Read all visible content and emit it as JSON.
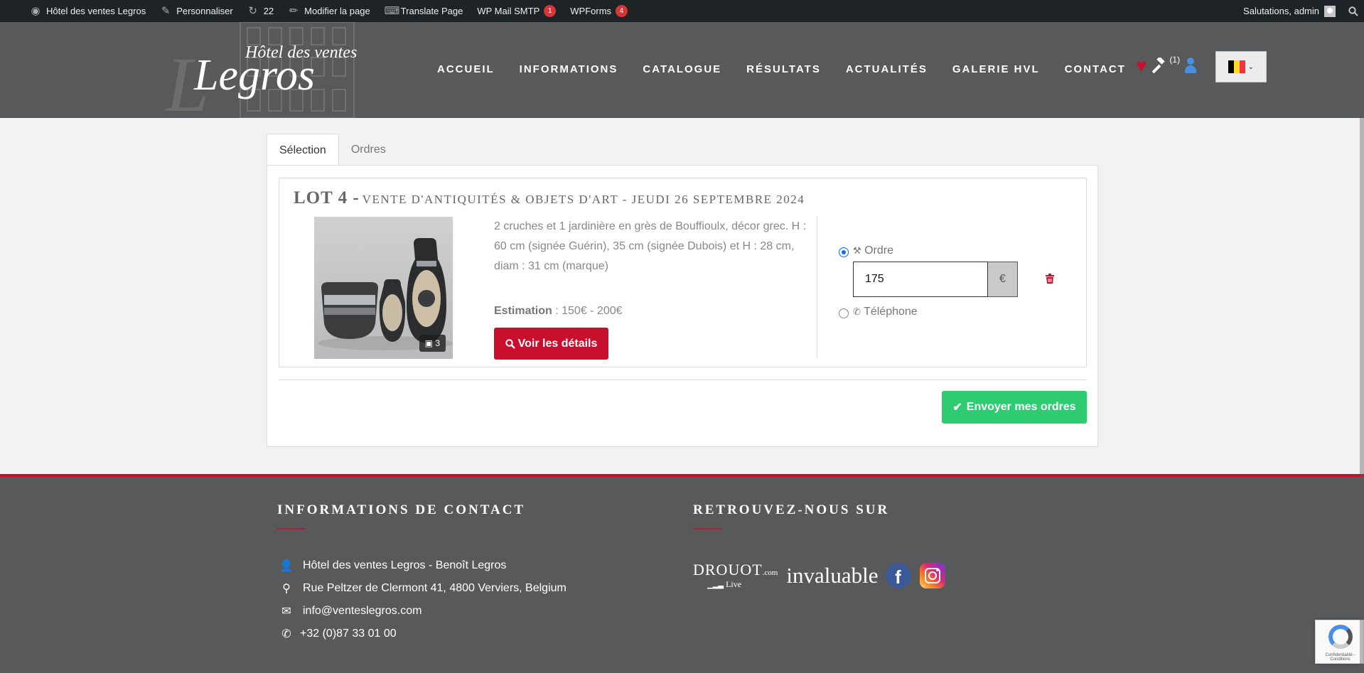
{
  "adminbar": {
    "site_name": "Hôtel des ventes Legros",
    "customize": "Personnaliser",
    "updates_count": "22",
    "edit_page": "Modifier la page",
    "translate": "Translate Page",
    "wp_mail": "WP Mail SMTP",
    "wp_mail_badge": "1",
    "wpforms": "WPForms",
    "wpforms_badge": "4",
    "greeting": "Salutations, admin"
  },
  "header": {
    "logo_line1": "Hôtel des ventes",
    "logo_line2": "Legros",
    "nav": [
      "ACCUEIL",
      "INFORMATIONS",
      "CATALOGUE",
      "RÉSULTATS",
      "ACTUALITÉS",
      "GALERIE HVL",
      "CONTACT"
    ],
    "bids_count": "(1)",
    "language_flag": "Belgium",
    "flag_colors": [
      "#000000",
      "#FDDA24",
      "#EF3340"
    ]
  },
  "tabs": [
    {
      "label": "Sélection",
      "active": true
    },
    {
      "label": "Ordres",
      "active": false
    }
  ],
  "lot": {
    "number": "LOT 4 -",
    "sale": "VENTE D'ANTIQUITÉS & OBJETS D'ART - JEUDI 26 SEPTEMBRE 2024",
    "description": "2 cruches et 1 jardinière en grès de Bouffioulx, décor grec. H : 60 cm (signée Guérin), 35 cm (signée Dubois) et H : 28 cm, diam : 31 cm (marque)",
    "estimation_label": "Estimation",
    "estimation_value": " : 150€ - 200€",
    "image_count": "3",
    "details_button": "Voir les détails",
    "option_order": "Ordre",
    "option_phone": "Téléphone",
    "order_selected": true,
    "amount": "175",
    "currency": "€"
  },
  "send_button": "Envoyer mes ordres",
  "footer": {
    "contact_title": "INFORMATIONS DE CONTACT",
    "social_title": "RETROUVEZ-NOUS SUR",
    "contact": {
      "name": "Hôtel des ventes Legros - Benoît Legros",
      "address": "Rue Peltzer de Clermont 41, 4800 Verviers, Belgium",
      "email": "info@venteslegros.com",
      "phone": "+32 (0)87 33 01 00"
    },
    "drouot": "DROUOT",
    "drouot_suffix": ".com",
    "drouot_live": "Live",
    "invaluable": "invaluable"
  },
  "recaptcha_text": "Confidentialité - Conditions",
  "colors": {
    "brand_red": "#c8102e",
    "header_gray": "#58595b",
    "success_green": "#2ecc71"
  }
}
